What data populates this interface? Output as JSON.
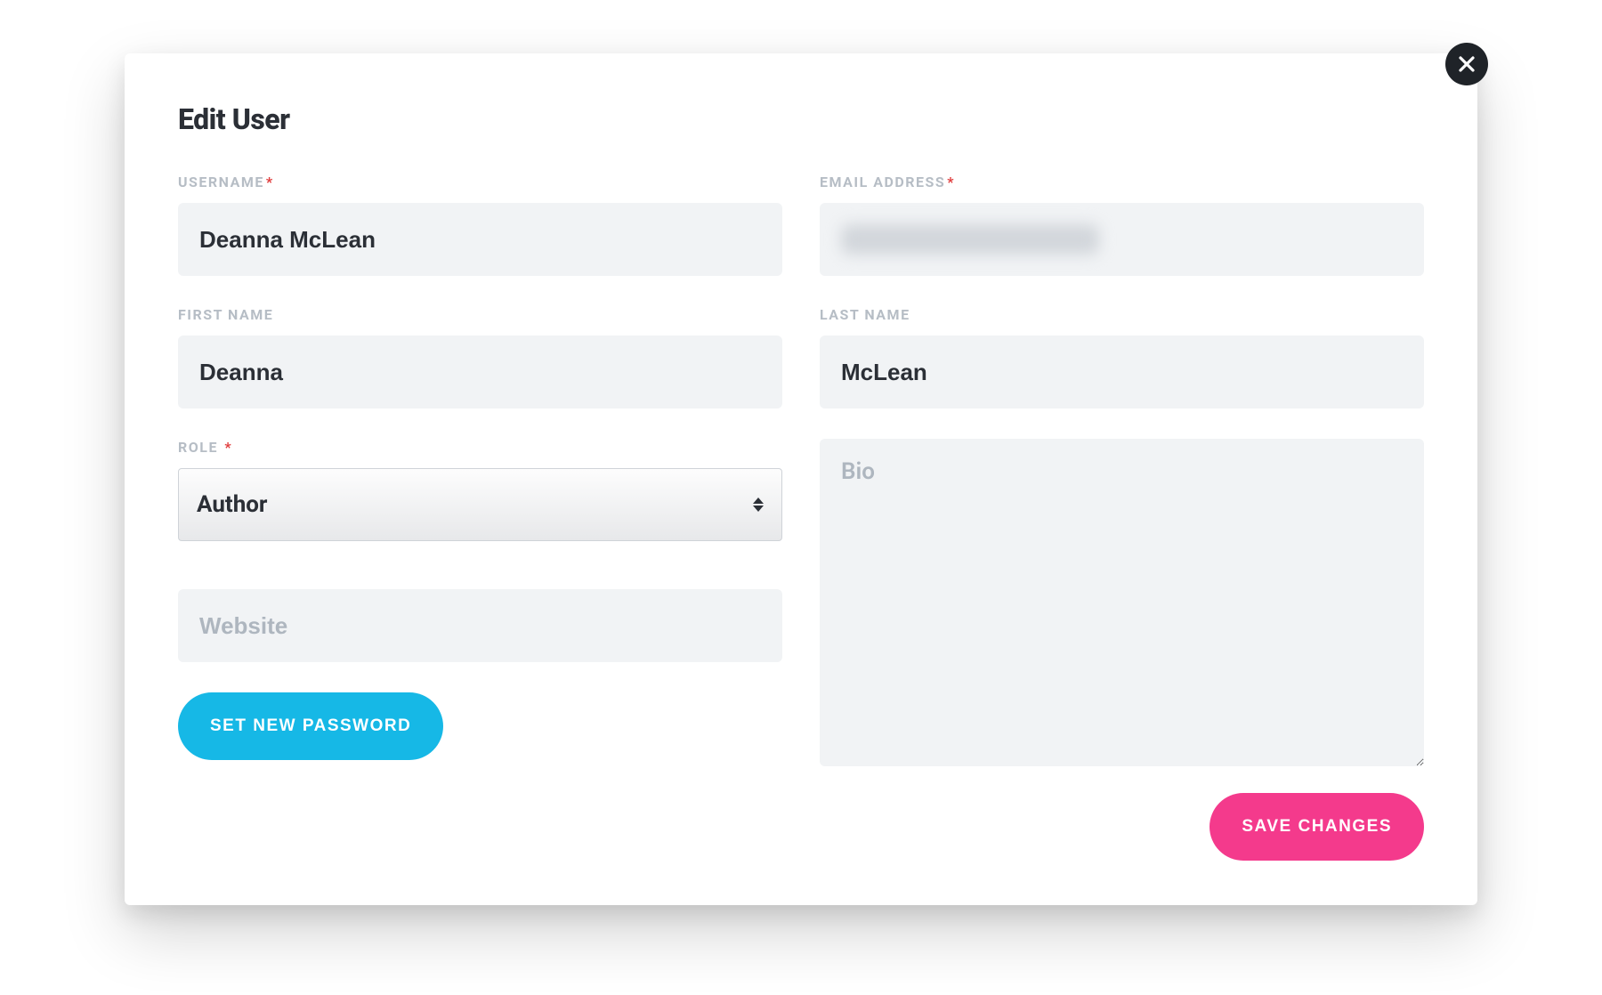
{
  "modal": {
    "title": "Edit User",
    "labels": {
      "username": "USERNAME",
      "email": "EMAIL ADDRESS",
      "first_name": "FIRST NAME",
      "last_name": "LAST NAME",
      "role": "ROLE"
    },
    "fields": {
      "username": "Deanna McLean",
      "email": "",
      "first_name": "Deanna",
      "last_name": "McLean",
      "role_selected": "Author",
      "website": "",
      "bio": ""
    },
    "placeholders": {
      "website": "Website",
      "bio": "Bio"
    },
    "buttons": {
      "set_password": "SET NEW PASSWORD",
      "save": "SAVE CHANGES"
    },
    "required_mark": "*",
    "colors": {
      "accent_blue": "#16b8e6",
      "accent_pink": "#f43a8c",
      "label_muted": "#b6bdc5",
      "input_bg": "#f1f3f5",
      "text": "#2b2f36",
      "required": "#e03c3c",
      "close_bg": "#1f2328"
    }
  }
}
